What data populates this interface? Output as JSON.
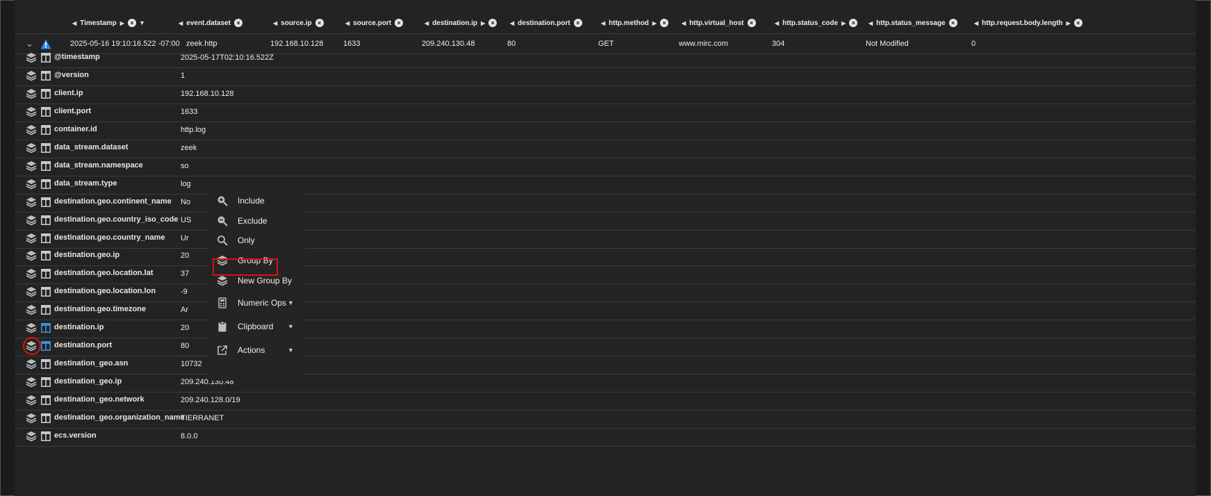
{
  "header": {
    "columns": [
      "Timestamp",
      "event.dataset",
      "source.ip",
      "source.port",
      "destination.ip",
      "destination.port",
      "http.method",
      "http.virtual_host",
      "http.status_code",
      "http.status_message",
      "http.request.body.length"
    ]
  },
  "event": {
    "timestamp": "2025-05-16 19:10:16.522 -07:00",
    "dataset": "zeek.http",
    "source_ip": "192.168.10.128",
    "source_port": "1633",
    "destination_ip": "209.240.130.48",
    "destination_port": "80",
    "http_method": "GET",
    "virtual_host": "www.mirc.com",
    "status_code": "304",
    "status_message": "Not Modified",
    "request_body_length": "0"
  },
  "fields": [
    {
      "name": "@timestamp",
      "value": "2025-05-17T02:10:16.522Z"
    },
    {
      "name": "@version",
      "value": "1"
    },
    {
      "name": "client.ip",
      "value": "192.168.10.128"
    },
    {
      "name": "client.port",
      "value": "1633"
    },
    {
      "name": "container.id",
      "value": "http.log"
    },
    {
      "name": "data_stream.dataset",
      "value": "zeek"
    },
    {
      "name": "data_stream.namespace",
      "value": "so"
    },
    {
      "name": "data_stream.type",
      "value": "log"
    },
    {
      "name": "destination.geo.continent_name",
      "value": "No"
    },
    {
      "name": "destination.geo.country_iso_code",
      "value": "US"
    },
    {
      "name": "destination.geo.country_name",
      "value": "Ur"
    },
    {
      "name": "destination.geo.ip",
      "value": "20"
    },
    {
      "name": "destination.geo.location.lat",
      "value": "37"
    },
    {
      "name": "destination.geo.location.lon",
      "value": "-9"
    },
    {
      "name": "destination.geo.timezone",
      "value": "Ar"
    },
    {
      "name": "destination.ip",
      "value": "20"
    },
    {
      "name": "destination.port",
      "value": "80"
    },
    {
      "name": "destination_geo.asn",
      "value": "10732"
    },
    {
      "name": "destination_geo.ip",
      "value": "209.240.130.48"
    },
    {
      "name": "destination_geo.network",
      "value": "209.240.128.0/19"
    },
    {
      "name": "destination_geo.organization_name",
      "value": "TIERRANET"
    },
    {
      "name": "ecs.version",
      "value": "8.0.0"
    }
  ],
  "context_menu": {
    "items": [
      {
        "label": "Include",
        "icon": "zoom-in-icon"
      },
      {
        "label": "Exclude",
        "icon": "zoom-out-icon"
      },
      {
        "label": "Only",
        "icon": "search-icon"
      },
      {
        "label": "Group By",
        "icon": "layers-icon"
      },
      {
        "label": "New Group By",
        "icon": "layers-icon"
      },
      {
        "label": "Numeric Ops",
        "icon": "calculator-icon"
      },
      {
        "label": "Clipboard",
        "icon": "clipboard-icon"
      },
      {
        "label": "Actions",
        "icon": "external-link-icon"
      }
    ]
  },
  "colors": {
    "background": "#1b1b1b",
    "table": "#232323",
    "highlight": "#dd1111",
    "warning": "#2f8ee0"
  }
}
